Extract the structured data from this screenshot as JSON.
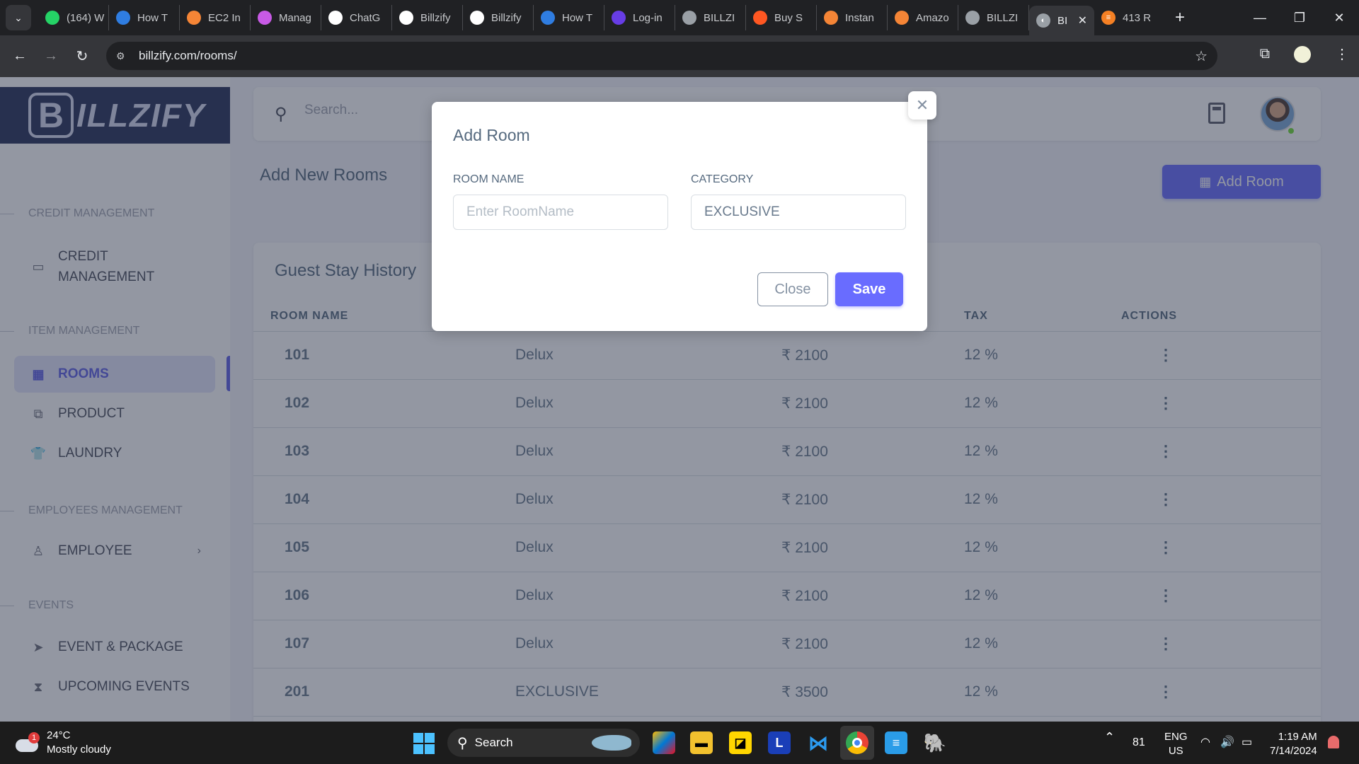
{
  "browser": {
    "tabs": [
      {
        "label": "(164) W",
        "icon": "whatsapp-icon",
        "color": "#25d366"
      },
      {
        "label": "How T",
        "icon": "loop-icon",
        "color": "#2f7de1"
      },
      {
        "label": "EC2 In",
        "icon": "aws-icon",
        "color": "#f58536"
      },
      {
        "label": "Manag",
        "icon": "cube-icon",
        "color": "#c85ae6"
      },
      {
        "label": "ChatG",
        "icon": "chatgpt-icon",
        "color": "#ffffff"
      },
      {
        "label": "Billzify",
        "icon": "github-icon",
        "color": "#ffffff"
      },
      {
        "label": "Billzify",
        "icon": "github-icon",
        "color": "#ffffff"
      },
      {
        "label": "How T",
        "icon": "loop-icon",
        "color": "#2f7de1"
      },
      {
        "label": "Log-in",
        "icon": "hostinger-icon",
        "color": "#673de6"
      },
      {
        "label": "BILLZI",
        "icon": "globe-icon",
        "color": "#9aa0a6"
      },
      {
        "label": "Buy S",
        "icon": "buy-icon",
        "color": "#ff5722"
      },
      {
        "label": "Instan",
        "icon": "instance-icon",
        "color": "#f58536"
      },
      {
        "label": "Amazo",
        "icon": "aws-icon",
        "color": "#f58536"
      },
      {
        "label": "BILLZI",
        "icon": "globe-icon",
        "color": "#9aa0a6"
      }
    ],
    "active_tab": {
      "label": "BI",
      "icon": "globe-icon"
    },
    "last_tab": {
      "label": "413 R",
      "icon": "stackoverflow-icon",
      "color": "#f48024"
    },
    "url": "billzify.com/rooms/"
  },
  "app": {
    "logo_letter": "B",
    "logo_text": "ILLZIFY",
    "search_placeholder": "Search...",
    "page_title": "Add New Rooms",
    "add_room_label": "Add Room",
    "card_title": "Guest Stay History"
  },
  "sidebar": {
    "sections": {
      "credit": "CREDIT MANAGEMENT",
      "item": "ITEM MANAGEMENT",
      "employees": "EMPLOYEES MANAGEMENT",
      "events": "EVENTS"
    },
    "items": {
      "credit": "CREDIT MANAGEMENT",
      "rooms": "ROOMS",
      "product": "PRODUCT",
      "laundry": "LAUNDRY",
      "employee": "EMPLOYEE",
      "event_package": "EVENT & PACKAGE",
      "upcoming": "UPCOMING EVENTS"
    }
  },
  "table": {
    "headers": {
      "room_name": "ROOM NAME",
      "tax": "TAX",
      "actions": "ACTIONS"
    },
    "rows": [
      {
        "room": "101",
        "category": "Delux",
        "price": "₹ 2100",
        "tax": "12 %"
      },
      {
        "room": "102",
        "category": "Delux",
        "price": "₹ 2100",
        "tax": "12 %"
      },
      {
        "room": "103",
        "category": "Delux",
        "price": "₹ 2100",
        "tax": "12 %"
      },
      {
        "room": "104",
        "category": "Delux",
        "price": "₹ 2100",
        "tax": "12 %"
      },
      {
        "room": "105",
        "category": "Delux",
        "price": "₹ 2100",
        "tax": "12 %"
      },
      {
        "room": "106",
        "category": "Delux",
        "price": "₹ 2100",
        "tax": "12 %"
      },
      {
        "room": "107",
        "category": "Delux",
        "price": "₹ 2100",
        "tax": "12 %"
      },
      {
        "room": "201",
        "category": "EXCLUSIVE",
        "price": "₹ 3500",
        "tax": "12 %"
      }
    ]
  },
  "modal": {
    "title": "Add Room",
    "room_name_label": "ROOM NAME",
    "room_name_placeholder": "Enter RoomName",
    "category_label": "CATEGORY",
    "category_value": "EXCLUSIVE",
    "close_label": "Close",
    "save_label": "Save"
  },
  "taskbar": {
    "weather_temp": "24°C",
    "weather_desc": "Mostly cloudy",
    "weather_badge": "1",
    "search_label": "Search",
    "battery": "81",
    "lang": "ENG",
    "region": "US",
    "time": "1:19 AM",
    "date": "7/14/2024"
  },
  "colors": {
    "primary": "#696cff",
    "logo_bg": "#263159"
  }
}
